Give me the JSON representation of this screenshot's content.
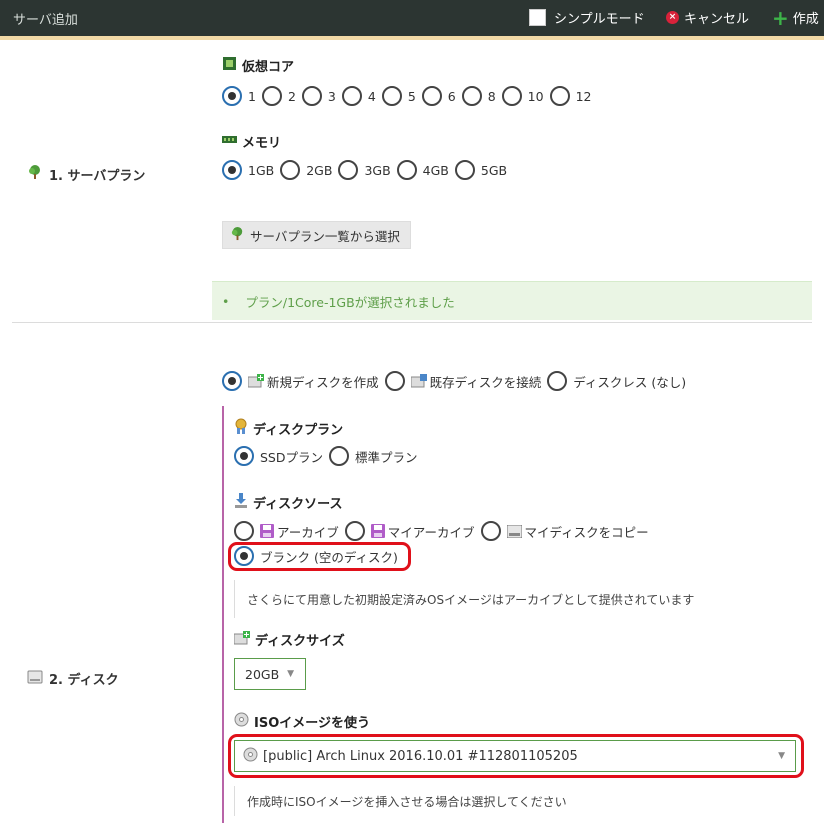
{
  "header": {
    "title": "サーバ追加",
    "simple_mode": "シンプルモード",
    "cancel": "キャンセル",
    "create": "作成"
  },
  "plan_section": {
    "label": "1. サーバプラン",
    "cpu_heading": "仮想コア",
    "cpu_options": [
      "1",
      "2",
      "3",
      "4",
      "5",
      "6",
      "8",
      "10",
      "12"
    ],
    "cpu_selected": "1",
    "memory_heading": "メモリ",
    "memory_options": [
      "1GB",
      "2GB",
      "3GB",
      "4GB",
      "5GB"
    ],
    "memory_selected": "1GB",
    "plan_list_button": "サーバプラン一覧から選択",
    "selected_message": "プラン/1Core-1GBが選択されました"
  },
  "disk_section": {
    "label": "2. ディスク",
    "disk_mode_options": [
      "新規ディスクを作成",
      "既存ディスクを接続",
      "ディスクレス (なし)"
    ],
    "disk_mode_selected": "新規ディスクを作成",
    "disk_plan_heading": "ディスクプラン",
    "disk_plan_options": [
      "SSDプラン",
      "標準プラン"
    ],
    "disk_plan_selected": "SSDプラン",
    "disk_source_heading": "ディスクソース",
    "disk_source_options": [
      "アーカイブ",
      "マイアーカイブ",
      "マイディスクをコピー",
      "ブランク (空のディスク)"
    ],
    "disk_source_selected": "ブランク (空のディスク)",
    "disk_source_help": "さくらにて用意した初期設定済みOSイメージはアーカイブとして提供されています",
    "disk_size_heading": "ディスクサイズ",
    "disk_size_value": "20GB",
    "iso_heading": "ISOイメージを使う",
    "iso_value": "[public] Arch Linux 2016.10.01 #112801105205",
    "iso_help": "作成時にISOイメージを挿入させる場合は選択してください"
  },
  "colors": {
    "header_bg": "#2c3532",
    "accent_green": "#5a9c4a",
    "section_line": "#b864a8",
    "highlight": "#e0101a"
  }
}
